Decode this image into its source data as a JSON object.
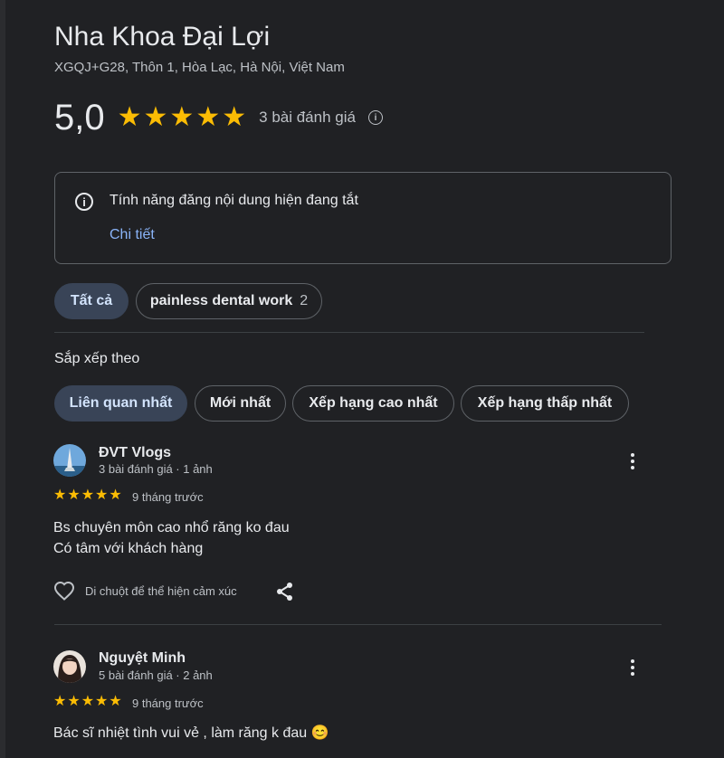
{
  "place": {
    "name": "Nha Khoa Đại Lợi",
    "address": "XGQJ+G28, Thôn 1, Hòa Lạc, Hà Nội, Việt Nam",
    "rating": "5,0",
    "stars": 5,
    "review_count": "3 bài đánh giá"
  },
  "notice": {
    "text": "Tính năng đăng nội dung hiện đang tắt",
    "link": "Chi tiết"
  },
  "filters": [
    {
      "label": "Tất cả",
      "count": "",
      "active": true
    },
    {
      "label": "painless dental work",
      "count": "2",
      "active": false
    }
  ],
  "sort": {
    "label": "Sắp xếp theo",
    "options": [
      {
        "label": "Liên quan nhất",
        "active": true
      },
      {
        "label": "Mới nhất",
        "active": false
      },
      {
        "label": "Xếp hạng cao nhất",
        "active": false
      },
      {
        "label": "Xếp hạng thấp nhất",
        "active": false
      }
    ]
  },
  "reviews": [
    {
      "author": "ĐVT Vlogs",
      "meta": "3 bài đánh giá · 1 ảnh",
      "stars": 5,
      "time": "9 tháng trước",
      "lines": [
        "Bs chuyên môn cao nhổ răng ko đau",
        "Có tâm với khách hàng"
      ],
      "reaction_hint": "Di chuột để thể hiện cảm xúc"
    },
    {
      "author": "Nguyệt Minh",
      "meta": "5 bài đánh giá · 2 ảnh",
      "stars": 5,
      "time": "9 tháng trước",
      "lines": [
        "Bác sĩ nhiệt tình vui vẻ , làm răng k đau 😊"
      ]
    }
  ],
  "colors": {
    "background": "#202124",
    "star": "#fbbc04",
    "link": "#8ab4f8",
    "active_chip": "#394457"
  },
  "icons": [
    "info-icon",
    "star-icon",
    "more-vert-icon",
    "heart-icon",
    "share-icon"
  ]
}
